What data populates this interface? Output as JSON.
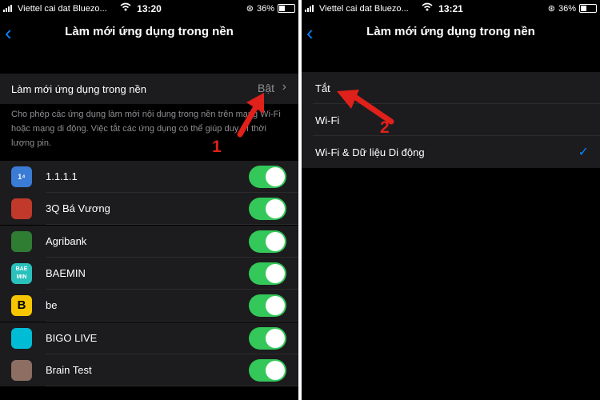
{
  "left": {
    "status": {
      "carrier": "Viettel cai dat Bluezo...",
      "time": "13:20",
      "battery": "36%"
    },
    "nav": {
      "title": "Làm mới ứng dụng trong nền"
    },
    "setting": {
      "label": "Làm mới ứng dụng trong nền",
      "value": "Bật"
    },
    "description": "Cho phép các ứng dụng làm mới nội dung trong nền trên mạng Wi-Fi hoặc mạng di động. Việc tắt các ứng dụng có thể giúp duy trì thời lượng pin.",
    "step_label": "1",
    "apps": [
      {
        "name": "1.1.1.1",
        "icon": "1.1.1.1-app-icon",
        "icon_text": "1⁴",
        "color": "#3a7bd5",
        "enabled": true
      },
      {
        "name": "3Q Bá Vương",
        "icon": "3q-ba-vuong-app-icon",
        "icon_text": "",
        "color": "#c0392b",
        "enabled": true
      },
      {
        "name": "Agribank",
        "icon": "agribank-app-icon",
        "icon_text": "",
        "color": "#2e7d32",
        "enabled": true
      },
      {
        "name": "BAEMIN",
        "icon": "baemin-app-icon",
        "icon_text": "BAE MIN",
        "color": "#2ac1bc",
        "enabled": true
      },
      {
        "name": "be",
        "icon": "be-app-icon",
        "icon_text": "B",
        "color": "#f7c600",
        "enabled": true
      },
      {
        "name": "BIGO LIVE",
        "icon": "bigo-live-app-icon",
        "icon_text": "",
        "color": "#00bcd4",
        "enabled": true
      },
      {
        "name": "Brain Test",
        "icon": "brain-test-app-icon",
        "icon_text": "",
        "color": "#8d6e63",
        "enabled": true
      }
    ]
  },
  "right": {
    "status": {
      "carrier": "Viettel cai dat Bluezo...",
      "time": "13:21",
      "battery": "36%"
    },
    "nav": {
      "title": "Làm mới ứng dụng trong nền"
    },
    "options": [
      {
        "label": "Tắt",
        "selected": false
      },
      {
        "label": "Wi-Fi",
        "selected": false
      },
      {
        "label": "Wi-Fi & Dữ liệu Di động",
        "selected": true
      }
    ],
    "checkmark": "✓",
    "step_label": "2"
  },
  "colors": {
    "accent": "#0a84ff",
    "toggle_on": "#34c759",
    "annotation": "#e0201a",
    "cell_bg": "#1c1c1e"
  }
}
